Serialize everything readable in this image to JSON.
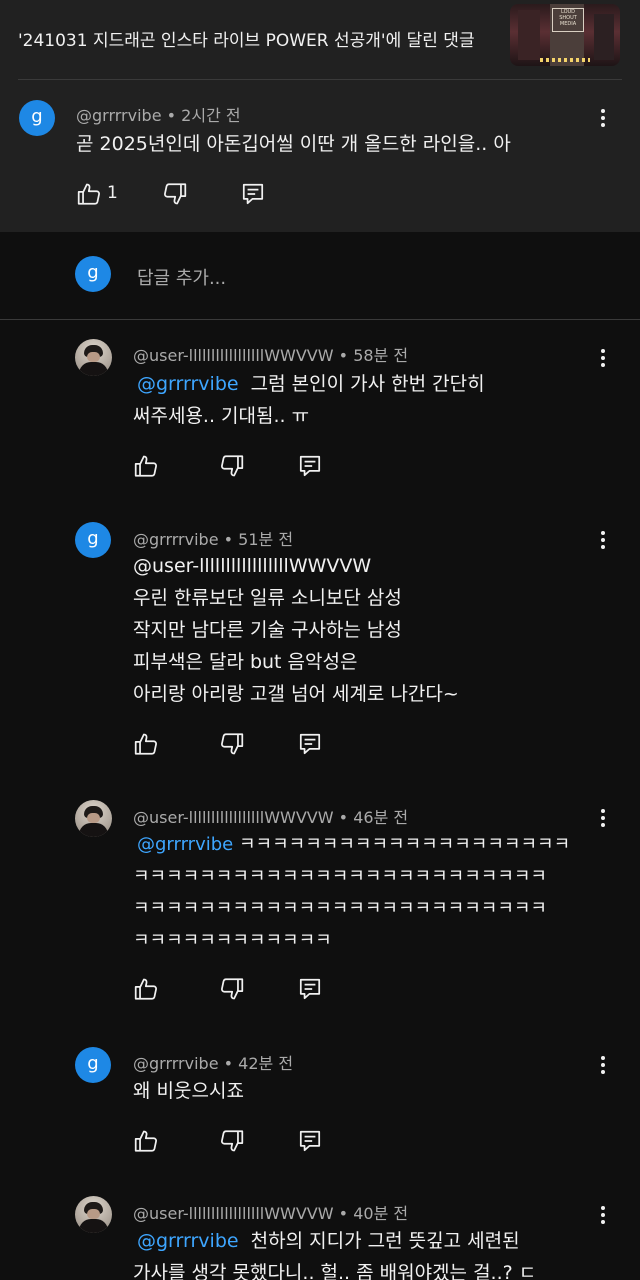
{
  "header": {
    "title": "'241031 지드래곤 인스타 라이브 POWER 선공개'에 달린 댓글",
    "thumbnail_sign": "LOUD SHOUT MEDIA"
  },
  "parent_comment": {
    "avatar_letter": "g",
    "author": "@grrrrvibe",
    "time": "2시간 전",
    "text": "곧 2025년인데 아돈깁어씰 이딴 개 올드한 라인을.. 아",
    "like_count": "1"
  },
  "reply_box": {
    "avatar_letter": "g",
    "placeholder": "답글 추가..."
  },
  "replies": [
    {
      "author": "@user-lllllllllllllllllWWVVW",
      "time": "58분 전",
      "mention": "@grrrrvibe",
      "line1": "그럼 본인이 가사 한번 간단히",
      "rest": "써주세용.. 기대됨.. ㅠ"
    },
    {
      "author": "@grrrrvibe",
      "time": "51분 전",
      "avatar_letter": "g",
      "text": "@user-lllllllllllllllllWWVVW\n우린 한류보단 일류 소니보단 삼성\n작지만 남다른 기술 구사하는 남성\n피부색은 달라 but 음악성은\n아리랑 아리랑 고갤 넘어 세계로 나간다~"
    },
    {
      "author": "@user-lllllllllllllllllWWVVW",
      "time": "46분 전",
      "mention": "@grrrrvibe",
      "line1": "ㅋㅋㅋㅋㅋㅋㅋㅋㅋㅋㅋㅋㅋㅋㅋㅋㅋㅋㅋㅋ",
      "rest": "ㅋㅋㅋㅋㅋㅋㅋㅋㅋㅋㅋㅋㅋㅋㅋㅋㅋㅋㅋㅋㅋㅋㅋㅋㅋ\nㅋㅋㅋㅋㅋㅋㅋㅋㅋㅋㅋㅋㅋㅋㅋㅋㅋㅋㅋㅋㅋㅋㅋㅋㅋ\nㅋㅋㅋㅋㅋㅋㅋㅋㅋㅋㅋㅋ"
    },
    {
      "author": "@grrrrvibe",
      "time": "42분 전",
      "avatar_letter": "g",
      "text": "왜 비웃으시죠"
    },
    {
      "author": "@user-lllllllllllllllllWWVVW",
      "time": "40분 전",
      "mention": "@grrrrvibe",
      "line1": "천하의 지디가 그런 뜻깊고 세련된",
      "rest": "가사를 생각 못했다니.. 헐.. 좀 배워야겠는 걸..? ㄷ"
    }
  ],
  "separator": "•",
  "colors": {
    "background": "#0f0f0f",
    "highlight_background": "#212121",
    "mention": "#3ea6ff",
    "avatar_blue": "#1e88e5",
    "meta_text": "#aaaaaa"
  },
  "icons": [
    "thumbs-up-icon",
    "thumbs-down-icon",
    "reply-comment-icon",
    "more-vert-icon"
  ]
}
